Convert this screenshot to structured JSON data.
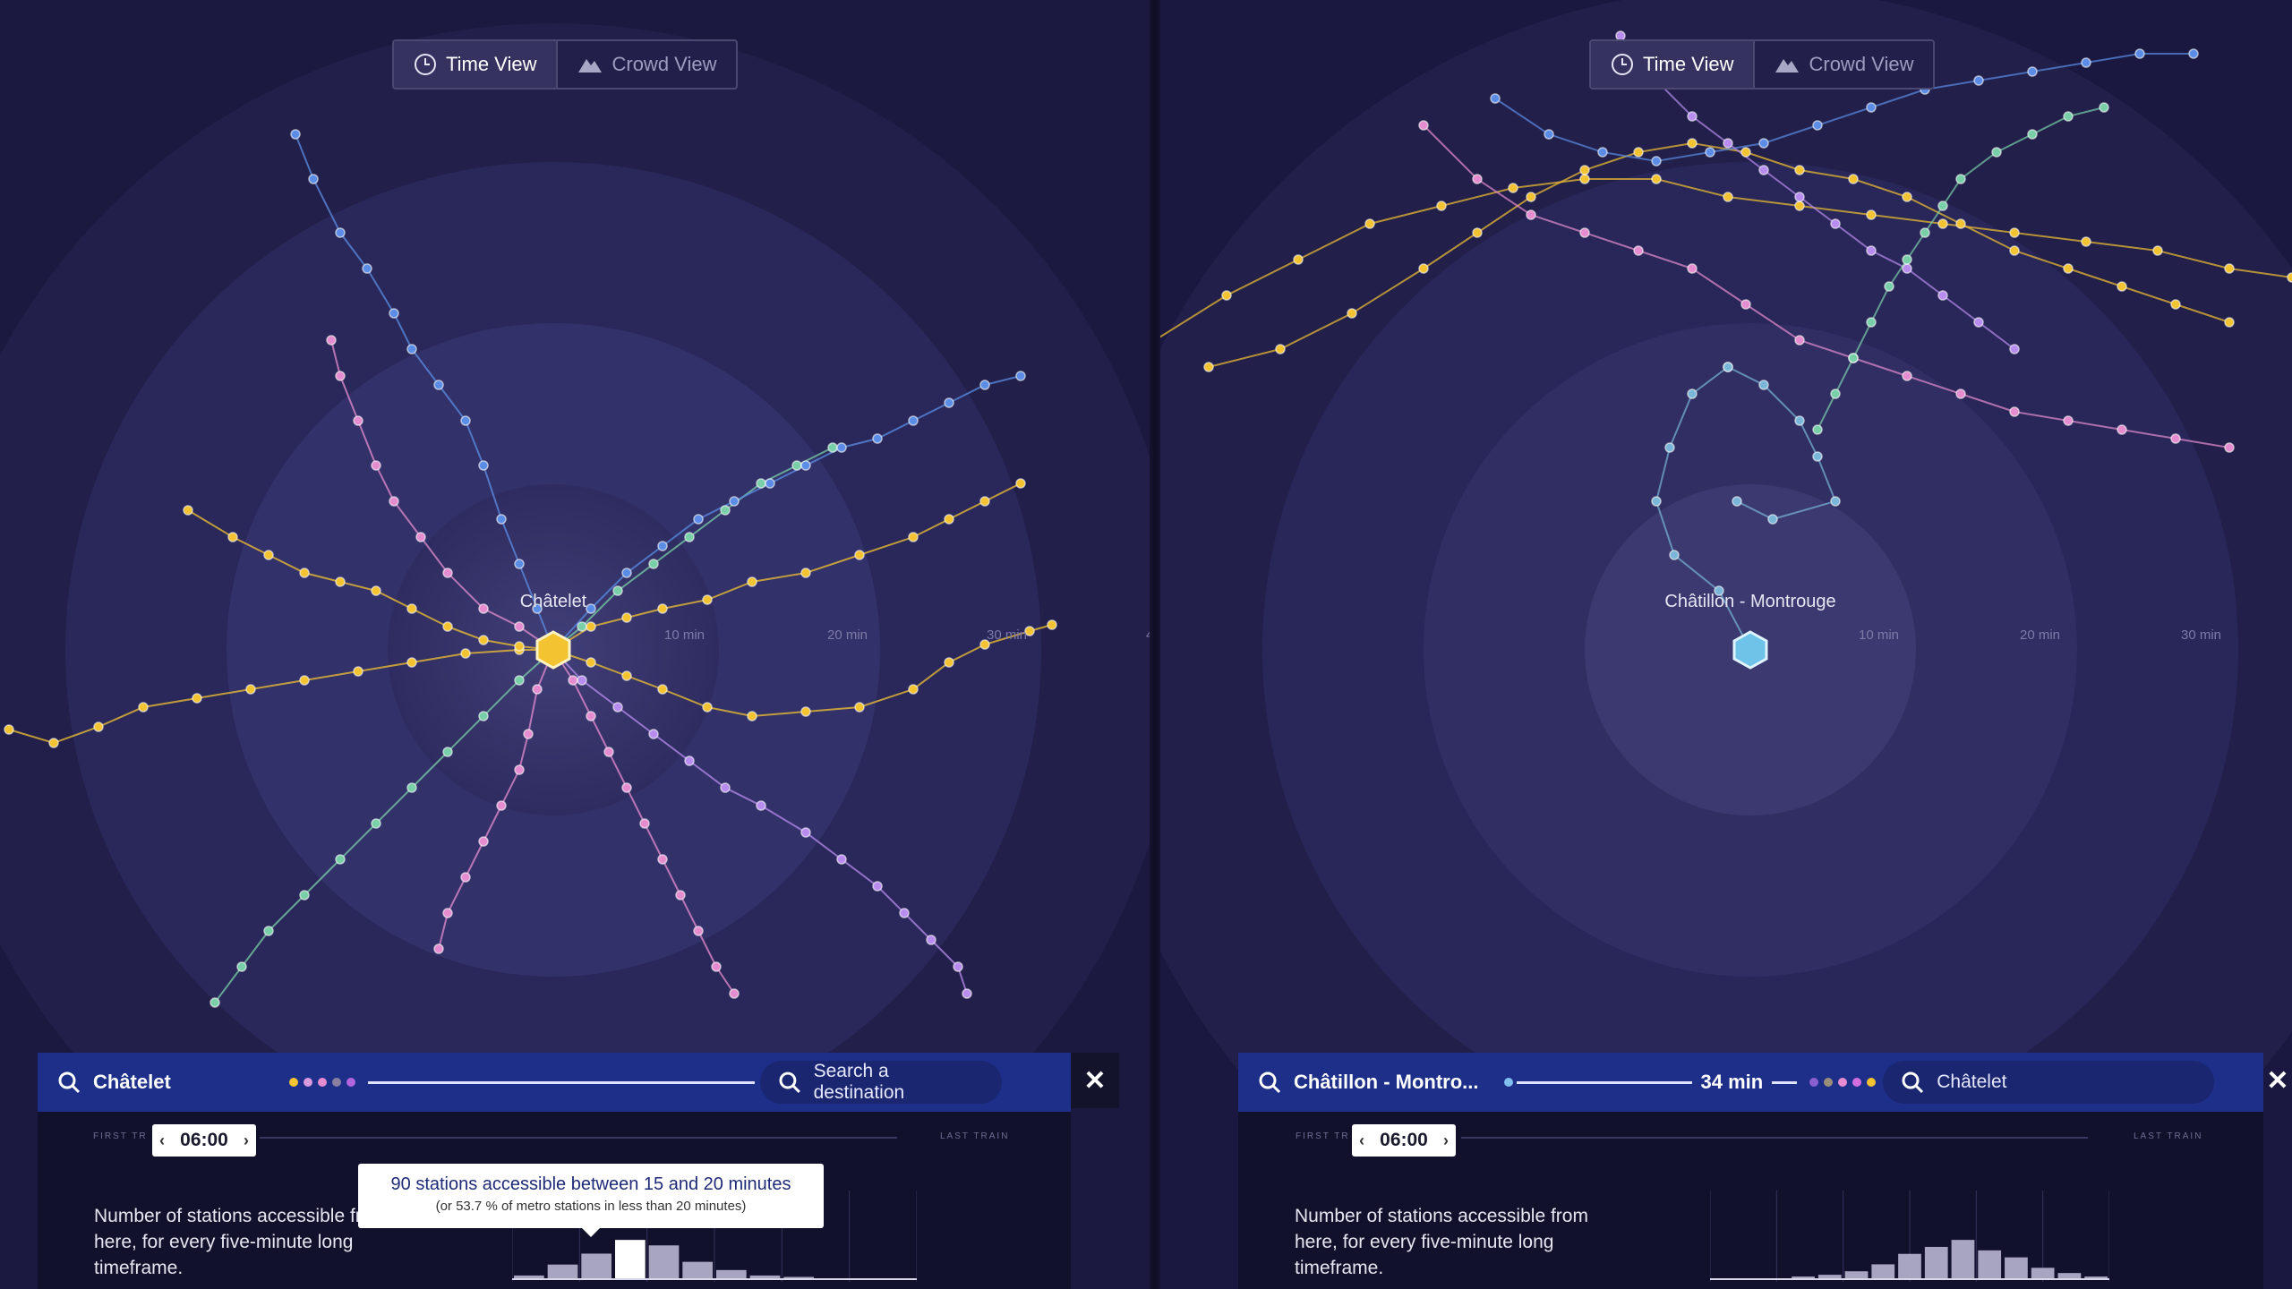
{
  "left": {
    "toggle": {
      "time_view": "Time View",
      "crowd_view": "Crowd View",
      "active": "time_view"
    },
    "center_station": "Châtelet",
    "rings": [
      "10 min",
      "20 min",
      "30 min"
    ],
    "edge_label": "4",
    "search": {
      "origin": "Châtelet",
      "destination_placeholder": "Search a destination"
    },
    "legend_dot_colors": [
      "#f3c331",
      "#d99adf",
      "#e58dd0",
      "#8a7fa0",
      "#b267e0"
    ],
    "first_train_label": "FIRST TR",
    "last_train_label": "LAST TRAIN",
    "time": "06:00",
    "description": "Number of stations accessible from here, for every five-minute long timeframe.",
    "tooltip": {
      "line1": "90 stations accessible between 15 and 20 minutes",
      "line2": "(or 53.7 % of metro stations in less than 20 minutes)"
    },
    "histogram": [
      2,
      10,
      18,
      28,
      24,
      12,
      6,
      2,
      1,
      0,
      0,
      0
    ]
  },
  "right": {
    "toggle": {
      "time_view": "Time View",
      "crowd_view": "Crowd View",
      "active": "time_view"
    },
    "center_station": "Châtillon - Montrouge",
    "rings": [
      "10 min",
      "20 min",
      "30 min"
    ],
    "search": {
      "origin": "Châtillon - Montro...",
      "duration": "34 min",
      "destination_value": "Châtelet"
    },
    "legend_dot_colors": [
      "#8a5fd0",
      "#9a8e7a",
      "#e58dd0",
      "#d36ee0",
      "#f3c331"
    ],
    "first_train_label": "FIRST TR",
    "last_train_label": "LAST TRAIN",
    "time": "06:00",
    "description": "Number of stations accessible from here, for every five-minute long timeframe.",
    "histogram": [
      0,
      0,
      0,
      1,
      2,
      4,
      8,
      14,
      18,
      22,
      16,
      12,
      6,
      3,
      1
    ]
  },
  "line_colors": [
    "#f3c331",
    "#e58dd0",
    "#79d0a8",
    "#5b8de6",
    "#b98cf0"
  ]
}
